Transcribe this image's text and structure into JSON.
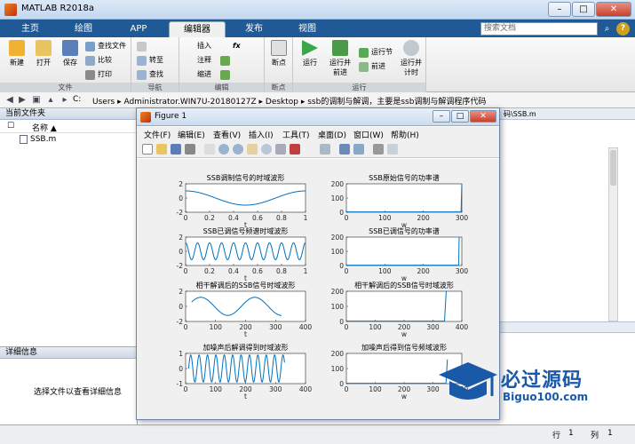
{
  "window": {
    "title": "MATLAB R2018a",
    "minimize": "–",
    "maximize": "□",
    "close": "✕"
  },
  "tabs": [
    "主页",
    "绘图",
    "APP",
    "编辑器",
    "发布",
    "视图"
  ],
  "search": {
    "placeholder": "搜索文档"
  },
  "help_label": "?",
  "ribbon": {
    "file": {
      "label": "文件",
      "new": "新建",
      "open": "打开",
      "save": "保存",
      "find_files": "查找文件",
      "compare": "比较",
      "print": "打印"
    },
    "nav": {
      "label": "导航",
      "goto": "转至",
      "find": "查找"
    },
    "edit": {
      "label": "编辑",
      "insert": "插入",
      "comment": "注释",
      "indent": "缩进",
      "fx": "fx"
    },
    "breakpoints": {
      "label": "断点",
      "btn": "断点"
    },
    "run": {
      "label": "运行",
      "run": "运行",
      "run_advance": "运行并\n前进",
      "run_section": "运行节",
      "advance": "前进",
      "run_time": "运行并\n计时"
    }
  },
  "address": {
    "drive": "C:",
    "path": "Users  ▸  Administrator.WIN7U-20180127Z  ▸  Desktop  ▸  ssb的调制与解调，主要是ssb调制与解调程序代码"
  },
  "current_folder": {
    "title": "当前文件夹",
    "col_name": "名称 ▲",
    "files": [
      "SSB.m"
    ]
  },
  "details": {
    "title": "详细信息",
    "hint": "选择文件以查看详细信息"
  },
  "editor_tab": "码\\SSB.m",
  "status": {
    "row_label": "行",
    "row": "1",
    "col_label": "列",
    "col": "1"
  },
  "figure": {
    "title": "Figure 1",
    "menu": [
      "文件(F)",
      "编辑(E)",
      "查看(V)",
      "插入(I)",
      "工具(T)",
      "桌面(D)",
      "窗口(W)",
      "帮助(H)"
    ]
  },
  "chart_data": [
    {
      "type": "line",
      "title": "SSB调制信号的时域波形",
      "xlabel": "t",
      "xlim": [
        0,
        1
      ],
      "ylim": [
        -2,
        2
      ],
      "xticks": [
        "0",
        "0.2",
        "0.4",
        "0.6",
        "0.8",
        "1"
      ],
      "yticks": [
        "2",
        "0",
        "-2"
      ],
      "description_series": "one cosine period, amplitude 1"
    },
    {
      "type": "line",
      "title": "SSB原始信号的功率谱",
      "xlabel": "w",
      "xlim": [
        0,
        300
      ],
      "ylim": [
        0,
        200
      ],
      "xticks": [
        "0",
        "100",
        "200",
        "300"
      ],
      "yticks": [
        "200",
        "100",
        "0"
      ]
    },
    {
      "type": "line",
      "title": "SSB已调信号频谱时域波形",
      "xlabel": "t",
      "xlim": [
        0,
        1
      ],
      "ylim": [
        -2,
        2
      ],
      "xticks": [
        "0",
        "0.2",
        "0.4",
        "0.6",
        "0.8",
        "1"
      ],
      "yticks": [
        "2",
        "0",
        "-2"
      ]
    },
    {
      "type": "line",
      "title": "SSB已调信号的功率谱",
      "xlabel": "w",
      "xlim": [
        0,
        300
      ],
      "ylim": [
        0,
        200
      ],
      "xticks": [
        "0",
        "100",
        "200",
        "300"
      ],
      "yticks": [
        "200",
        "100",
        "0"
      ]
    },
    {
      "type": "line",
      "title": "相干解调后的SSB信号时域波形",
      "xlabel": "t",
      "xlim": [
        0,
        400
      ],
      "ylim": [
        -2,
        2
      ],
      "xticks": [
        "0",
        "100",
        "200",
        "300",
        "400"
      ],
      "yticks": [
        "2",
        "0",
        "-2"
      ]
    },
    {
      "type": "line",
      "title": "相干解调后的SSB信号时域波形",
      "xlabel": "w",
      "xlim": [
        0,
        400
      ],
      "ylim": [
        0,
        200
      ],
      "xticks": [
        "0",
        "100",
        "200",
        "300",
        "400"
      ],
      "yticks": [
        "200",
        "100",
        "0"
      ]
    },
    {
      "type": "line",
      "title": "加噪声后解调得到时域波形",
      "xlabel": "t",
      "xlim": [
        0,
        400
      ],
      "ylim": [
        -1,
        1
      ],
      "xticks": [
        "0",
        "100",
        "200",
        "300",
        "400"
      ],
      "yticks": [
        "1",
        "0",
        "-1"
      ]
    },
    {
      "type": "line",
      "title": "加噪声后得到信号频域波形",
      "xlabel": "w",
      "xlim": [
        0,
        400
      ],
      "ylim": [
        0,
        200
      ],
      "xticks": [
        "0",
        "100",
        "200",
        "300",
        "400"
      ],
      "yticks": [
        "200",
        "100",
        "0"
      ]
    }
  ],
  "watermark": {
    "text": "必过源码",
    "sub": "Biguo100.com"
  }
}
